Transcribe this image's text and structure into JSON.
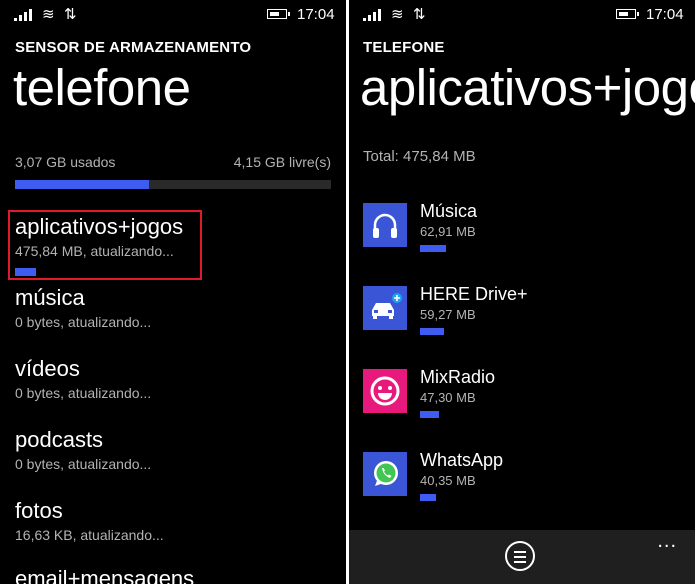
{
  "status": {
    "time": "17:04"
  },
  "left": {
    "section": "SENSOR DE ARMAZENAMENTO",
    "title": "telefone",
    "used": "3,07 GB usados",
    "free": "4,15 GB livre(s)",
    "usage_fraction": 0.425,
    "categories": [
      {
        "name": "aplicativos+jogos",
        "detail": "475,84 MB, atualizando..."
      },
      {
        "name": "música",
        "detail": "0 bytes, atualizando..."
      },
      {
        "name": "vídeos",
        "detail": "0 bytes, atualizando..."
      },
      {
        "name": "podcasts",
        "detail": "0 bytes, atualizando..."
      },
      {
        "name": "fotos",
        "detail": "16,63 KB, atualizando..."
      },
      {
        "name": "email+mensagens",
        "detail": ""
      }
    ]
  },
  "right": {
    "section": "TELEFONE",
    "title": "aplicativos+jogos",
    "total_label": "Total:",
    "total_value": "475,84 MB",
    "apps": [
      {
        "name": "Música",
        "size": "62,91 MB",
        "icon": "headphones-icon"
      },
      {
        "name": "HERE Drive+",
        "size": "59,27 MB",
        "icon": "car-icon"
      },
      {
        "name": "MixRadio",
        "size": "47,30 MB",
        "icon": "smiley-icon"
      },
      {
        "name": "WhatsApp",
        "size": "40,35 MB",
        "icon": "whatsapp-icon"
      }
    ],
    "appbar_more": "..."
  },
  "colors": {
    "accent": "#3e5cf0",
    "highlight": "#e0192b",
    "tile": "#3a55d6"
  }
}
